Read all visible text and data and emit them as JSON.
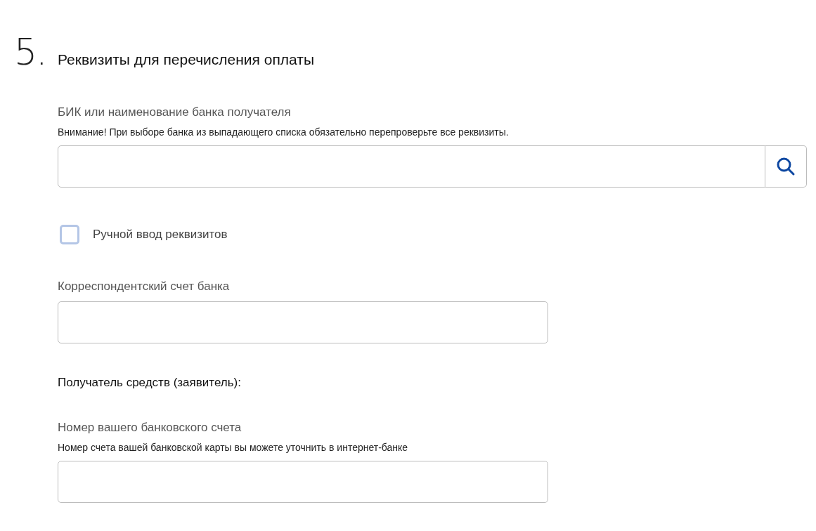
{
  "section": {
    "number": "5.",
    "title": "Реквизиты для перечисления оплаты"
  },
  "items": [
    {
      "kind": "search_field",
      "label": "БИК или наименование банка получателя",
      "note": "Внимание! При выборе банка из выпадающего списка обязательно перепроверьте все реквизиты."
    },
    {
      "kind": "checkbox",
      "label": "Ручной ввод реквизитов",
      "checked": false
    },
    {
      "kind": "field",
      "label": "Корреспондентский счет банка"
    },
    {
      "kind": "heading",
      "label": "Получатель средств (заявитель):"
    },
    {
      "kind": "field",
      "label": "Номер вашего банковского счета",
      "note": "Номер счета вашей банковской карты вы можете уточнить в интернет-банке"
    }
  ]
}
